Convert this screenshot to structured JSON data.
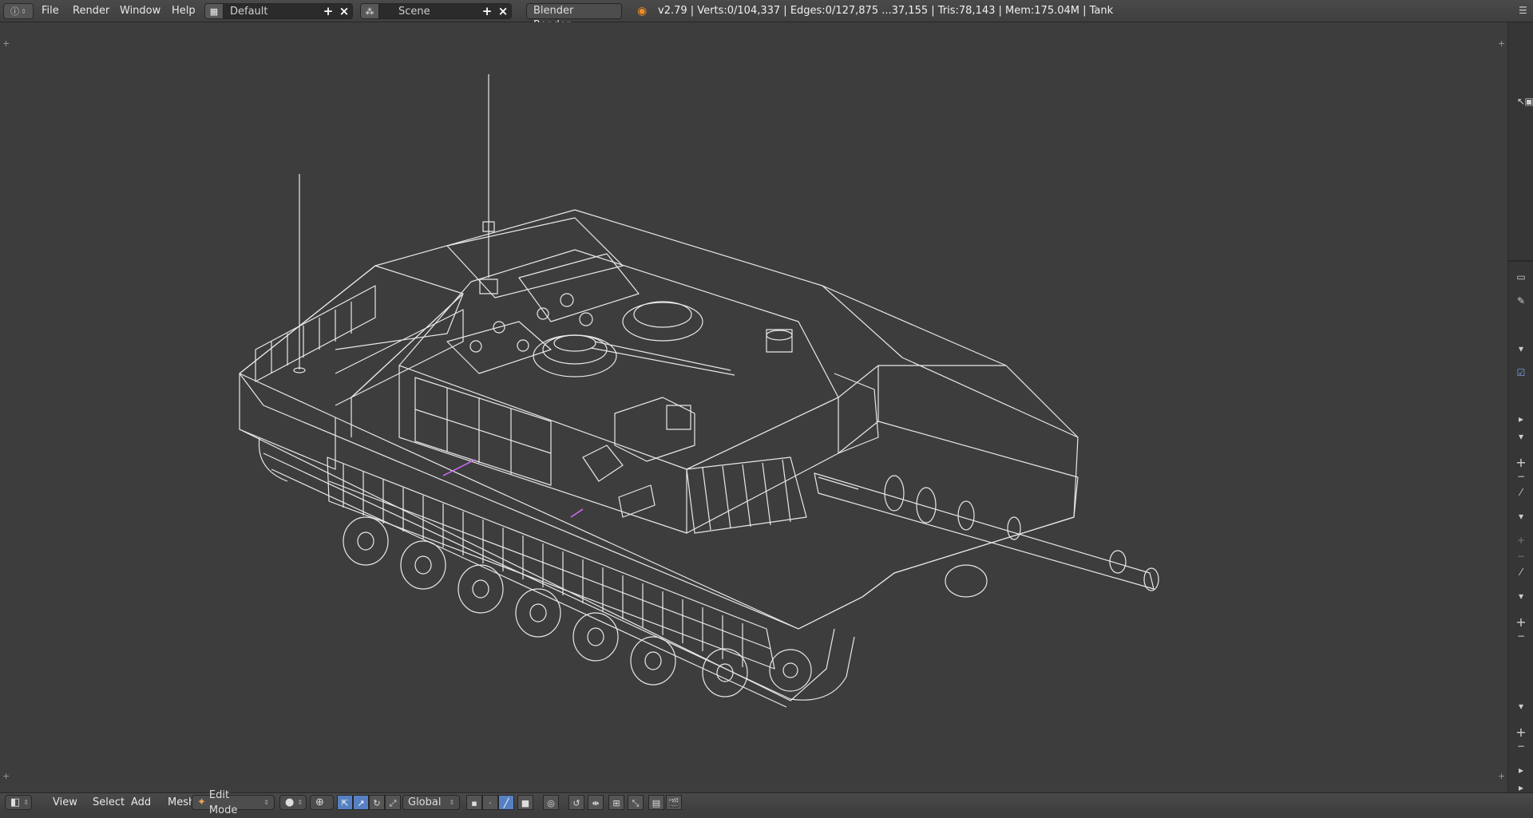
{
  "topbar": {
    "menus": [
      "File",
      "Render",
      "Window",
      "Help"
    ],
    "screen_layout": "Default",
    "scene": "Scene",
    "render_engine": "Blender Render",
    "stats": "v2.79 | Verts:0/104,337 | Edges:0/127,875 ...37,155 | Tris:78,143 | Mem:175.04M | Tank"
  },
  "bottombar": {
    "menus": [
      "View",
      "Select",
      "Add",
      "Mesh"
    ],
    "mode": "Edit Mode",
    "orientation": "Global"
  },
  "icons": {
    "info": "info-icon",
    "layout": "screen-layout-icon",
    "scene": "scene-icon",
    "logo": "blender-logo-icon",
    "viewport_type": "3d-view-icon",
    "mode": "edit-mode-icon",
    "shading": "viewport-shading-icon",
    "pivot": "pivot-point-icon",
    "manipulator": "manipulator-icons",
    "select_mode": "select-mode-icons",
    "snap": "snap-icon",
    "render_preview": "opengl-render-icon"
  },
  "colors": {
    "viewport_bg": "#3d3d3d",
    "wireframe": "#e8e8e8",
    "selected_edge": "#d86bff",
    "accent_active": "#5680c2",
    "logo": "#f08a24"
  }
}
